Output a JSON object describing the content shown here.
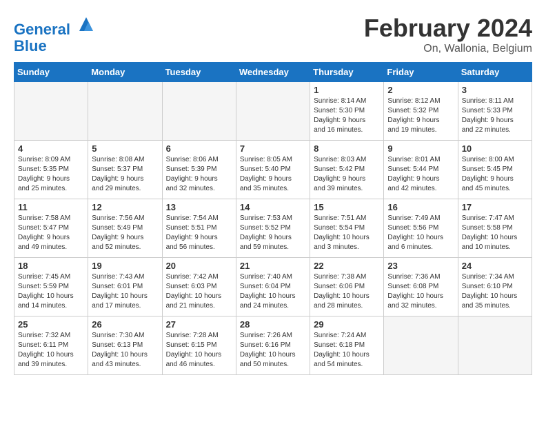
{
  "header": {
    "logo_line1": "General",
    "logo_line2": "Blue",
    "month_title": "February 2024",
    "location": "On, Wallonia, Belgium"
  },
  "weekdays": [
    "Sunday",
    "Monday",
    "Tuesday",
    "Wednesday",
    "Thursday",
    "Friday",
    "Saturday"
  ],
  "weeks": [
    [
      {
        "day": "",
        "info": ""
      },
      {
        "day": "",
        "info": ""
      },
      {
        "day": "",
        "info": ""
      },
      {
        "day": "",
        "info": ""
      },
      {
        "day": "1",
        "info": "Sunrise: 8:14 AM\nSunset: 5:30 PM\nDaylight: 9 hours\nand 16 minutes."
      },
      {
        "day": "2",
        "info": "Sunrise: 8:12 AM\nSunset: 5:32 PM\nDaylight: 9 hours\nand 19 minutes."
      },
      {
        "day": "3",
        "info": "Sunrise: 8:11 AM\nSunset: 5:33 PM\nDaylight: 9 hours\nand 22 minutes."
      }
    ],
    [
      {
        "day": "4",
        "info": "Sunrise: 8:09 AM\nSunset: 5:35 PM\nDaylight: 9 hours\nand 25 minutes."
      },
      {
        "day": "5",
        "info": "Sunrise: 8:08 AM\nSunset: 5:37 PM\nDaylight: 9 hours\nand 29 minutes."
      },
      {
        "day": "6",
        "info": "Sunrise: 8:06 AM\nSunset: 5:39 PM\nDaylight: 9 hours\nand 32 minutes."
      },
      {
        "day": "7",
        "info": "Sunrise: 8:05 AM\nSunset: 5:40 PM\nDaylight: 9 hours\nand 35 minutes."
      },
      {
        "day": "8",
        "info": "Sunrise: 8:03 AM\nSunset: 5:42 PM\nDaylight: 9 hours\nand 39 minutes."
      },
      {
        "day": "9",
        "info": "Sunrise: 8:01 AM\nSunset: 5:44 PM\nDaylight: 9 hours\nand 42 minutes."
      },
      {
        "day": "10",
        "info": "Sunrise: 8:00 AM\nSunset: 5:45 PM\nDaylight: 9 hours\nand 45 minutes."
      }
    ],
    [
      {
        "day": "11",
        "info": "Sunrise: 7:58 AM\nSunset: 5:47 PM\nDaylight: 9 hours\nand 49 minutes."
      },
      {
        "day": "12",
        "info": "Sunrise: 7:56 AM\nSunset: 5:49 PM\nDaylight: 9 hours\nand 52 minutes."
      },
      {
        "day": "13",
        "info": "Sunrise: 7:54 AM\nSunset: 5:51 PM\nDaylight: 9 hours\nand 56 minutes."
      },
      {
        "day": "14",
        "info": "Sunrise: 7:53 AM\nSunset: 5:52 PM\nDaylight: 9 hours\nand 59 minutes."
      },
      {
        "day": "15",
        "info": "Sunrise: 7:51 AM\nSunset: 5:54 PM\nDaylight: 10 hours\nand 3 minutes."
      },
      {
        "day": "16",
        "info": "Sunrise: 7:49 AM\nSunset: 5:56 PM\nDaylight: 10 hours\nand 6 minutes."
      },
      {
        "day": "17",
        "info": "Sunrise: 7:47 AM\nSunset: 5:58 PM\nDaylight: 10 hours\nand 10 minutes."
      }
    ],
    [
      {
        "day": "18",
        "info": "Sunrise: 7:45 AM\nSunset: 5:59 PM\nDaylight: 10 hours\nand 14 minutes."
      },
      {
        "day": "19",
        "info": "Sunrise: 7:43 AM\nSunset: 6:01 PM\nDaylight: 10 hours\nand 17 minutes."
      },
      {
        "day": "20",
        "info": "Sunrise: 7:42 AM\nSunset: 6:03 PM\nDaylight: 10 hours\nand 21 minutes."
      },
      {
        "day": "21",
        "info": "Sunrise: 7:40 AM\nSunset: 6:04 PM\nDaylight: 10 hours\nand 24 minutes."
      },
      {
        "day": "22",
        "info": "Sunrise: 7:38 AM\nSunset: 6:06 PM\nDaylight: 10 hours\nand 28 minutes."
      },
      {
        "day": "23",
        "info": "Sunrise: 7:36 AM\nSunset: 6:08 PM\nDaylight: 10 hours\nand 32 minutes."
      },
      {
        "day": "24",
        "info": "Sunrise: 7:34 AM\nSunset: 6:10 PM\nDaylight: 10 hours\nand 35 minutes."
      }
    ],
    [
      {
        "day": "25",
        "info": "Sunrise: 7:32 AM\nSunset: 6:11 PM\nDaylight: 10 hours\nand 39 minutes."
      },
      {
        "day": "26",
        "info": "Sunrise: 7:30 AM\nSunset: 6:13 PM\nDaylight: 10 hours\nand 43 minutes."
      },
      {
        "day": "27",
        "info": "Sunrise: 7:28 AM\nSunset: 6:15 PM\nDaylight: 10 hours\nand 46 minutes."
      },
      {
        "day": "28",
        "info": "Sunrise: 7:26 AM\nSunset: 6:16 PM\nDaylight: 10 hours\nand 50 minutes."
      },
      {
        "day": "29",
        "info": "Sunrise: 7:24 AM\nSunset: 6:18 PM\nDaylight: 10 hours\nand 54 minutes."
      },
      {
        "day": "",
        "info": ""
      },
      {
        "day": "",
        "info": ""
      }
    ]
  ]
}
